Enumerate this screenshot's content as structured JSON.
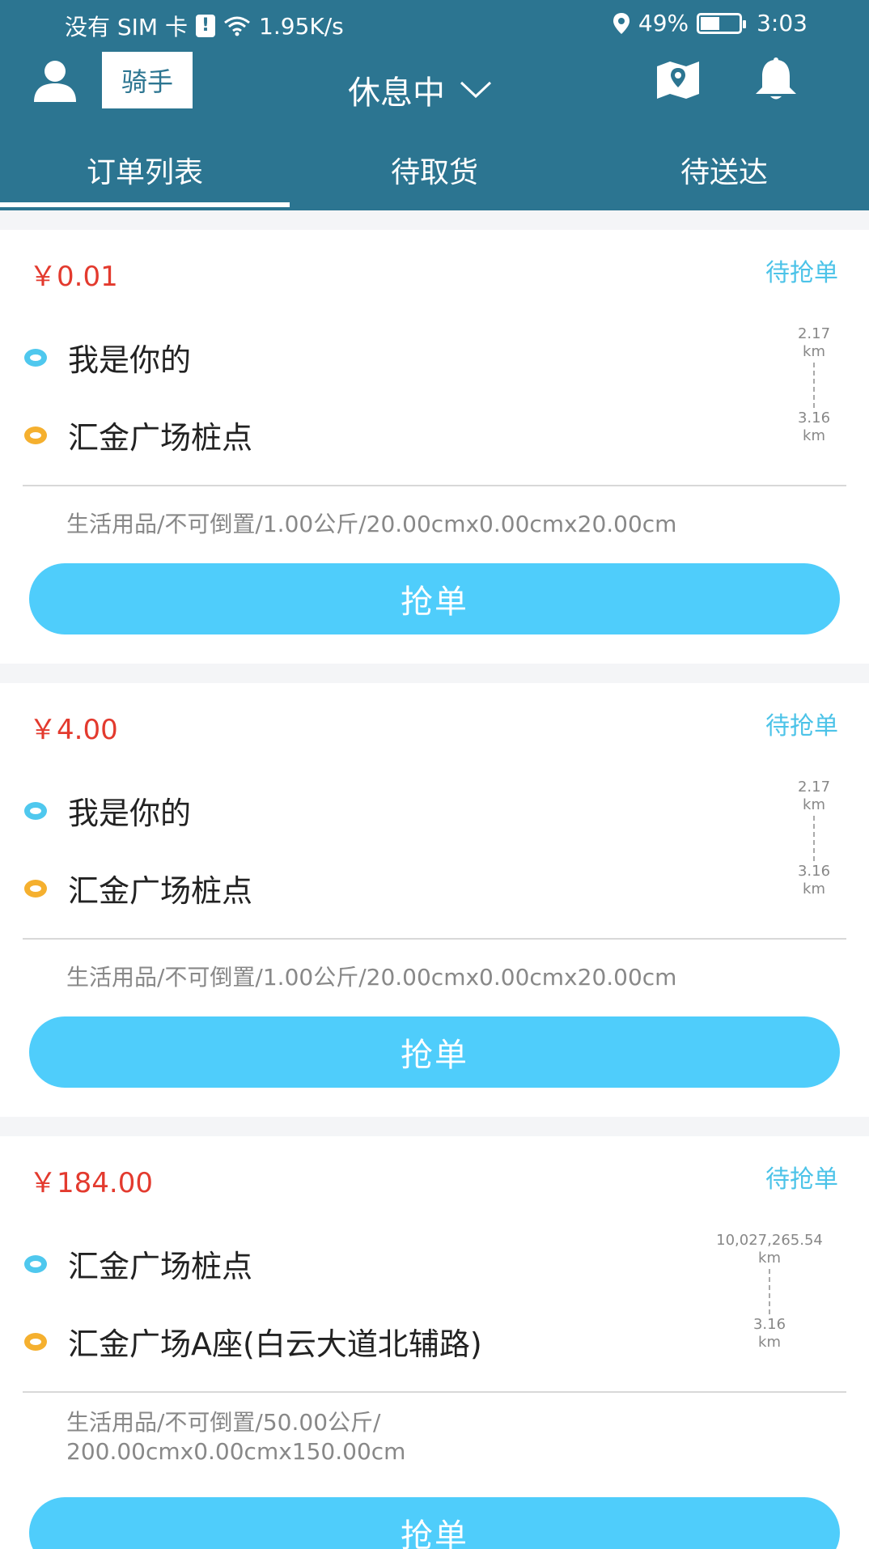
{
  "statusbar": {
    "sim": "没有 SIM 卡",
    "sim_alert": "!",
    "speed": "1.95K/s",
    "battery": "49%",
    "time": "3:03"
  },
  "topbar": {
    "role": "骑手",
    "work_status": "休息中"
  },
  "tabs": [
    {
      "label": "订单列表",
      "active": true
    },
    {
      "label": "待取货",
      "active": false
    },
    {
      "label": "待送达",
      "active": false
    }
  ],
  "orders": [
    {
      "price": "￥0.01",
      "state": "待抢单",
      "from": "我是你的",
      "to": "汇金广场桩点",
      "dist_top": "2.17",
      "dist_top_unit": "km",
      "dist_bot": "3.16",
      "dist_bot_unit": "km",
      "desc": "生活用品/不可倒置/1.00公斤/20.00cmx0.00cmx20.00cm",
      "button": "抢单"
    },
    {
      "price": "￥4.00",
      "state": "待抢单",
      "from": "我是你的",
      "to": "汇金广场桩点",
      "dist_top": "2.17",
      "dist_top_unit": "km",
      "dist_bot": "3.16",
      "dist_bot_unit": "km",
      "desc": "生活用品/不可倒置/1.00公斤/20.00cmx0.00cmx20.00cm",
      "button": "抢单"
    },
    {
      "price": "￥184.00",
      "state": "待抢单",
      "from": "汇金广场桩点",
      "to": "汇金广场A座(白云大道北辅路)",
      "dist_top": "10,027,265.54",
      "dist_top_unit": "km",
      "dist_bot": "3.16",
      "dist_bot_unit": "km",
      "desc": "生活用品/不可倒置/50.00公斤/ 200.00cmx0.00cmx150.00cm",
      "button": "抢单"
    }
  ]
}
